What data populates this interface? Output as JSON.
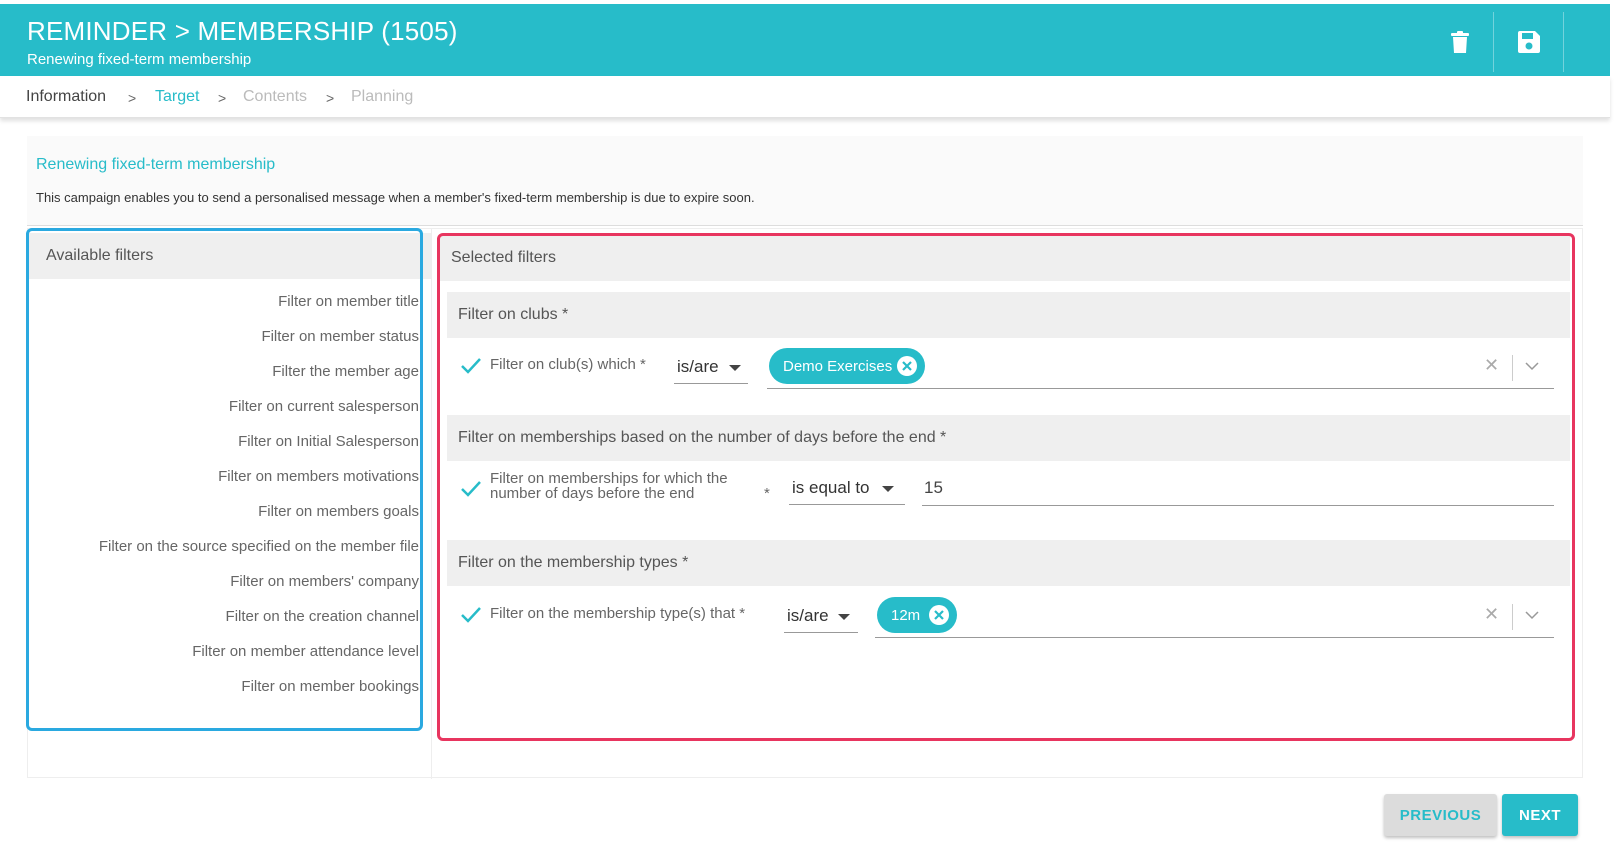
{
  "header": {
    "title": "REMINDER > MEMBERSHIP (1505)",
    "subtitle": "Renewing fixed-term membership",
    "delete_icon": "trash-icon",
    "save_icon": "floppy-disk-icon"
  },
  "steps": [
    {
      "label": "Information",
      "state": "done"
    },
    {
      "label": "Target",
      "state": "active"
    },
    {
      "label": "Contents",
      "state": "disabled"
    },
    {
      "label": "Planning",
      "state": "disabled"
    }
  ],
  "description": {
    "title": "Renewing fixed-term membership",
    "text": "This campaign enables you to send a personalised message when a member's fixed-term membership is due to expire soon."
  },
  "available_filters": {
    "heading": "Available filters",
    "items": [
      "Filter on member title",
      "Filter on member status",
      "Filter the member age",
      "Filter on current salesperson",
      "Filter on Initial Salesperson",
      "Filter on members motivations",
      "Filter on members goals",
      "Filter on the source specified on the member file",
      "Filter on members' company",
      "Filter on the creation channel",
      "Filter on member attendance level",
      "Filter on member bookings"
    ]
  },
  "selected_filters": {
    "heading": "Selected filters",
    "groups": [
      {
        "title": "Filter on clubs *",
        "label": "Filter on club(s) which *",
        "operator": "is/are",
        "chips": [
          "Demo Exercises"
        ]
      },
      {
        "title": "Filter on memberships based on the number of days before the end *",
        "label_line1": "Filter on memberships for which the",
        "label_line2": "number of days before the end",
        "required_mark": "*",
        "operator": "is equal to",
        "value": "15"
      },
      {
        "title": "Filter on the membership types  *",
        "label": "Filter on the membership type(s) that *",
        "operator": "is/are",
        "chips": [
          "12m"
        ]
      }
    ]
  },
  "buttons": {
    "previous": "PREVIOUS",
    "next": "NEXT"
  },
  "colors": {
    "brand": "#27bcc9",
    "highlight_blue": "#2aa9e0",
    "highlight_red": "#e8355f"
  }
}
